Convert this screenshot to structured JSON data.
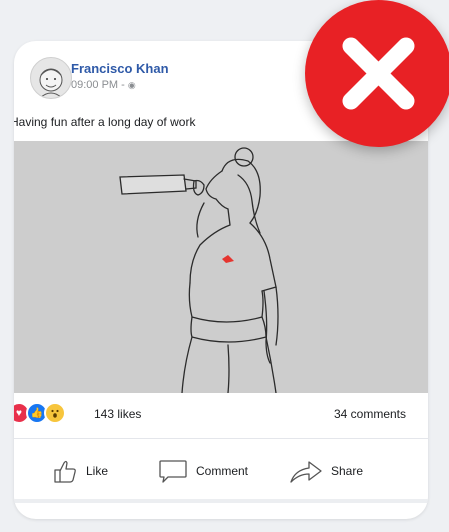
{
  "post": {
    "author": "Francisco Khan",
    "time": "09:00 PM",
    "separator": "-",
    "caption": "Having fun after a long day of work"
  },
  "stats": {
    "likes": "143 likes",
    "comments": "34 comments"
  },
  "actions": {
    "like": "Like",
    "comment": "Comment",
    "share": "Share"
  },
  "icons": {
    "privacy": "globe-icon",
    "reject_badge": "close-icon"
  },
  "colors": {
    "author": "#2f5aa8",
    "badge": "#e82125",
    "love": "#e8304b",
    "like": "#1877f2",
    "wow": "#f7c53c"
  }
}
